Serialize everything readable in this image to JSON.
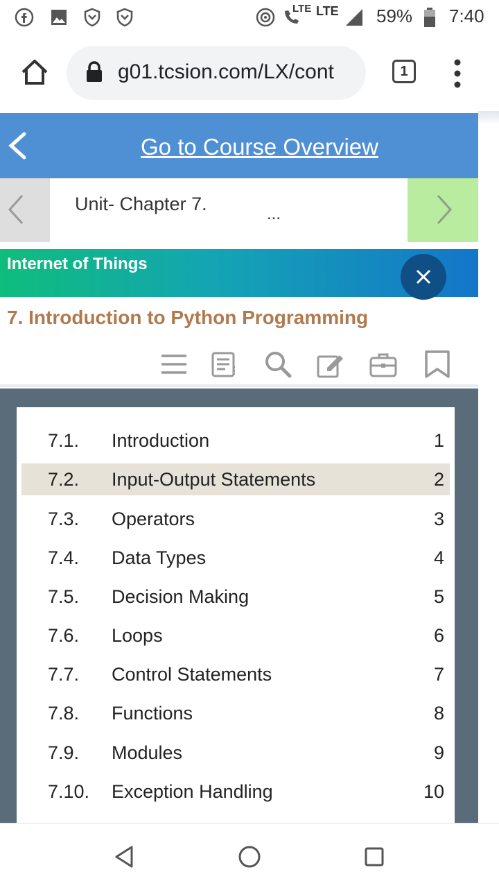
{
  "status_bar": {
    "icons": [
      "facebook-icon",
      "gallery-icon",
      "shield-icon",
      "shield-icon",
      "hotspot-icon",
      "volte-call-icon",
      "signal-icon",
      "battery-icon"
    ],
    "volte_label": "LTE",
    "network_label": "LTE",
    "battery": "59%",
    "time": "7:40"
  },
  "browser": {
    "url": "g01.tcsion.com/LX/cont",
    "tab_count": "1",
    "icons": [
      "home-icon",
      "lock-icon",
      "tabs-icon",
      "more-vert-icon"
    ]
  },
  "course": {
    "link_label": "Go to Course Overview",
    "header_color": "#4f8fd3"
  },
  "chapter_nav": {
    "label": "Unit- Chapter 7.",
    "ellipsis": "...",
    "next_color": "#b9ec9e"
  },
  "subject": {
    "title": "Internet of Things"
  },
  "chapter": {
    "title": "7. Introduction to Python Programming",
    "title_color": "#b07a4e"
  },
  "toolbar": {
    "icons": [
      "menu-icon",
      "notes-icon",
      "search-icon",
      "edit-icon",
      "briefcase-icon",
      "bookmark-icon"
    ]
  },
  "toc": {
    "active_index": 1,
    "items": [
      {
        "num": "7.1.",
        "name": "Introduction",
        "page": "1"
      },
      {
        "num": "7.2.",
        "name": "Input-Output Statements",
        "page": "2"
      },
      {
        "num": "7.3.",
        "name": "Operators",
        "page": "3"
      },
      {
        "num": "7.4.",
        "name": "Data Types",
        "page": "4"
      },
      {
        "num": "7.5.",
        "name": "Decision Making",
        "page": "5"
      },
      {
        "num": "7.6.",
        "name": "Loops",
        "page": "6"
      },
      {
        "num": "7.7.",
        "name": "Control Statements",
        "page": "7"
      },
      {
        "num": "7.8.",
        "name": "Functions",
        "page": "8"
      },
      {
        "num": "7.9.",
        "name": "Modules",
        "page": "9"
      },
      {
        "num": "7.10.",
        "name": "Exception Handling",
        "page": "10"
      }
    ]
  },
  "nav_bar": {
    "icons": [
      "back-icon",
      "home-circle-icon",
      "recents-icon"
    ]
  }
}
